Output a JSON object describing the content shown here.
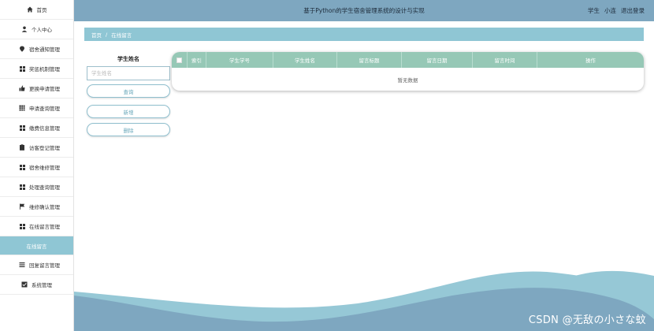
{
  "header": {
    "title": "基于Python的学生宿舍管理系统的设计与实现",
    "user_role": "学生",
    "user_name": "小连",
    "logout": "退出登录"
  },
  "sidebar": {
    "items": [
      {
        "label": "首页",
        "icon": "home-icon"
      },
      {
        "label": "个人中心",
        "icon": "person-icon"
      },
      {
        "label": "宿舍通知管理",
        "icon": "pin-icon"
      },
      {
        "label": "奖惩机制管理",
        "icon": "grid-icon"
      },
      {
        "label": "更换申请管理",
        "icon": "thumbs-up-icon"
      },
      {
        "label": "申请查询管理",
        "icon": "table-icon"
      },
      {
        "label": "缴费信息管理",
        "icon": "grid-icon"
      },
      {
        "label": "访客登记管理",
        "icon": "clipboard-icon"
      },
      {
        "label": "宿舍维修管理",
        "icon": "grid-icon"
      },
      {
        "label": "处理查询管理",
        "icon": "grid-icon"
      },
      {
        "label": "维修确认管理",
        "icon": "flag-icon"
      },
      {
        "label": "在线留言管理",
        "icon": "grid-icon"
      }
    ],
    "active_sub": "在线留言",
    "items_after": [
      {
        "label": "回复留言管理",
        "icon": "list-icon"
      },
      {
        "label": "系统管理",
        "icon": "checkbox-icon"
      }
    ]
  },
  "breadcrumb": {
    "home": "首页",
    "separator": "/",
    "current": "在线留言"
  },
  "search": {
    "label": "学生姓名",
    "placeholder": "学生姓名",
    "query_button": "查询",
    "add_button": "新增",
    "delete_button": "删除"
  },
  "table": {
    "columns": [
      "索引",
      "学生学号",
      "学生姓名",
      "留言标题",
      "留言日期",
      "留言时间",
      "操作"
    ],
    "empty_text": "暂无数据"
  },
  "colors": {
    "header_bg": "#7ea7c0",
    "accent": "#8fc6d4",
    "table_header": "#96c8b6",
    "wave_dark": "#7ea7c0",
    "wave_light": "#96c8d6"
  },
  "watermark": "CSDN @无敌の小さな蚊"
}
